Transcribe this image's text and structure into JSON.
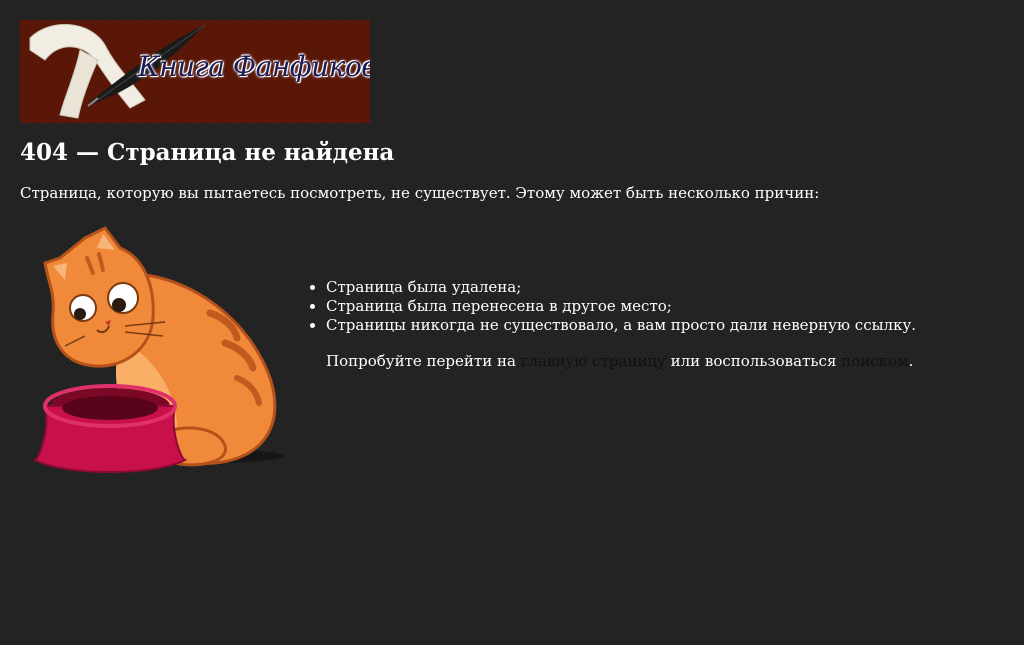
{
  "logo": {
    "text": "Книга Фанфиков",
    "icon": "ribbon-quill-icon"
  },
  "page_title": "404 — Страница не найдена",
  "intro": "Страница, которую вы пытаетесь посмотреть, не существует. Этому может быть несколько причин:",
  "reasons": [
    "Страница была удалена;",
    "Страница была перенесена в другое место;",
    "Страницы никогда не существовало, а вам просто дали неверную ссылку."
  ],
  "suggestion": {
    "prefix": "Попробуйте перейти на ",
    "home_link": "главную страницу",
    "middle": " или воспользоваться ",
    "search_link": "поиском",
    "suffix": "."
  },
  "illustration": {
    "icon": "sad-cat-with-bowl-icon"
  },
  "colors": {
    "background": "#222222",
    "text": "#ffffff",
    "logo_background": "#5a1708",
    "logo_text": "#1e1a52",
    "link": "#111111",
    "cat_orange": "#f08a3a",
    "bowl_red": "#c8104a"
  }
}
